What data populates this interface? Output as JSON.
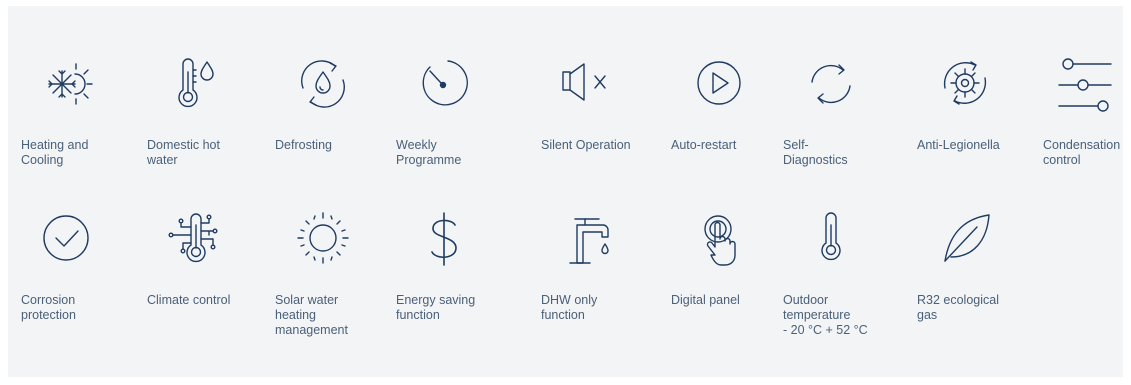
{
  "colors": {
    "icon": "#1f3b61",
    "text": "#4a6079",
    "background": "#f3f4f6"
  },
  "features": [
    {
      "label": "Heating and\nCooling",
      "icon": "snowflake-sun-icon"
    },
    {
      "label": "Domestic hot\nwater",
      "icon": "thermometer-drop-icon"
    },
    {
      "label": "Defrosting",
      "icon": "drop-cycle-icon"
    },
    {
      "label": "Weekly\nProgramme",
      "icon": "timer-icon"
    },
    {
      "label": "Silent Operation",
      "icon": "speaker-mute-icon"
    },
    {
      "label": "Auto-restart",
      "icon": "play-circle-icon"
    },
    {
      "label": "Self-\nDiagnostics",
      "icon": "sync-arrows-icon"
    },
    {
      "label": "Anti-Legionella",
      "icon": "gear-cycle-icon"
    },
    {
      "label": "Condensation\ncontrol",
      "icon": "sliders-icon"
    },
    {
      "label": "Corrosion\nprotection",
      "icon": "check-circle-icon"
    },
    {
      "label": "Climate control",
      "icon": "circuit-thermometer-icon"
    },
    {
      "label": "Solar water\nheating\nmanagement",
      "icon": "sun-icon"
    },
    {
      "label": "Energy saving\nfunction",
      "icon": "dollar-icon"
    },
    {
      "label": "DHW only\nfunction",
      "icon": "faucet-icon"
    },
    {
      "label": "Digital panel",
      "icon": "touch-button-icon"
    },
    {
      "label": "Outdoor\ntemperature\n- 20 °C + 52 °C",
      "icon": "thermometer-icon"
    },
    {
      "label": "R32 ecological\ngas",
      "icon": "leaf-icon"
    }
  ]
}
